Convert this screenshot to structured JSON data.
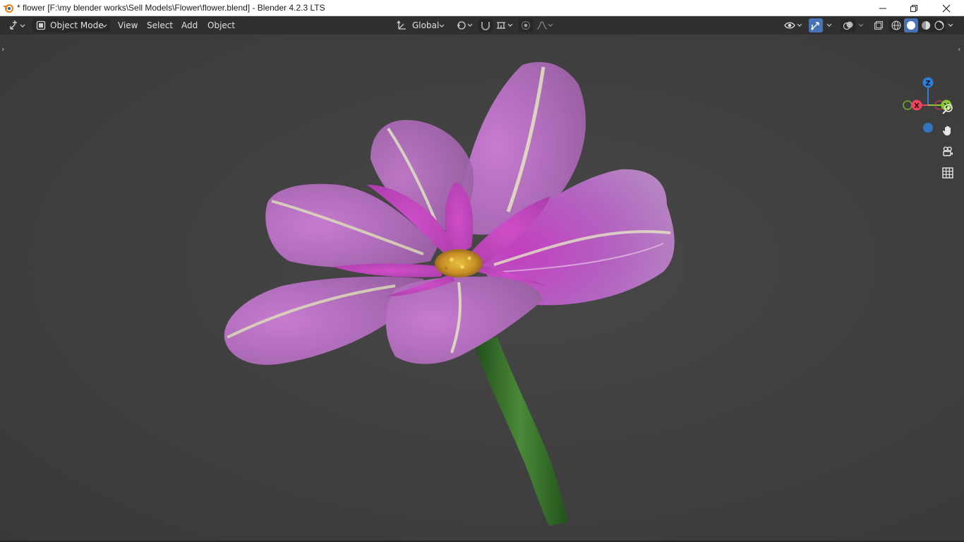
{
  "window": {
    "title": "* flower [F:\\my blender works\\Sell Models\\Flower\\flower.blend] - Blender 4.2.3 LTS"
  },
  "header": {
    "editor_type_icon": "editor-type-icon",
    "mode_label": "Object Mode",
    "menus": [
      "View",
      "Select",
      "Add",
      "Object"
    ],
    "transform_orientation": "Global",
    "pivot_icon": "pivot-icon",
    "snap_icon": "snap-magnet-icon",
    "snap_target_icon": "snap-increment-icon",
    "proportional_icon": "proportional-edit-icon",
    "falloff_icon": "falloff-curve-icon",
    "visibility_icon": "eye-visibility-icon",
    "gizmo_icon": "gizmo-toggle-icon",
    "overlay_icon": "overlay-icon",
    "xray_icon": "xray-icon",
    "shading_modes": [
      "wireframe-shading-icon",
      "solid-shading-icon",
      "material-preview-icon",
      "rendered-shading-icon"
    ],
    "active_shading": "solid-shading-icon"
  },
  "viewport": {
    "axes": {
      "x": "X",
      "y": "Y",
      "z": "Z"
    },
    "nav_icons": [
      "zoom-icon",
      "hand-pan-icon",
      "camera-icon",
      "grid-icon"
    ],
    "object": "flower",
    "colors": {
      "background": "#3d3d3d",
      "petal": "#b86cc0",
      "petal_vein": "#d9e6b0",
      "stem": "#3d7a2e",
      "center": "#d9a531",
      "axis_x": "#f0435d",
      "axis_y": "#8ac730",
      "axis_z": "#2f7fd6"
    }
  }
}
